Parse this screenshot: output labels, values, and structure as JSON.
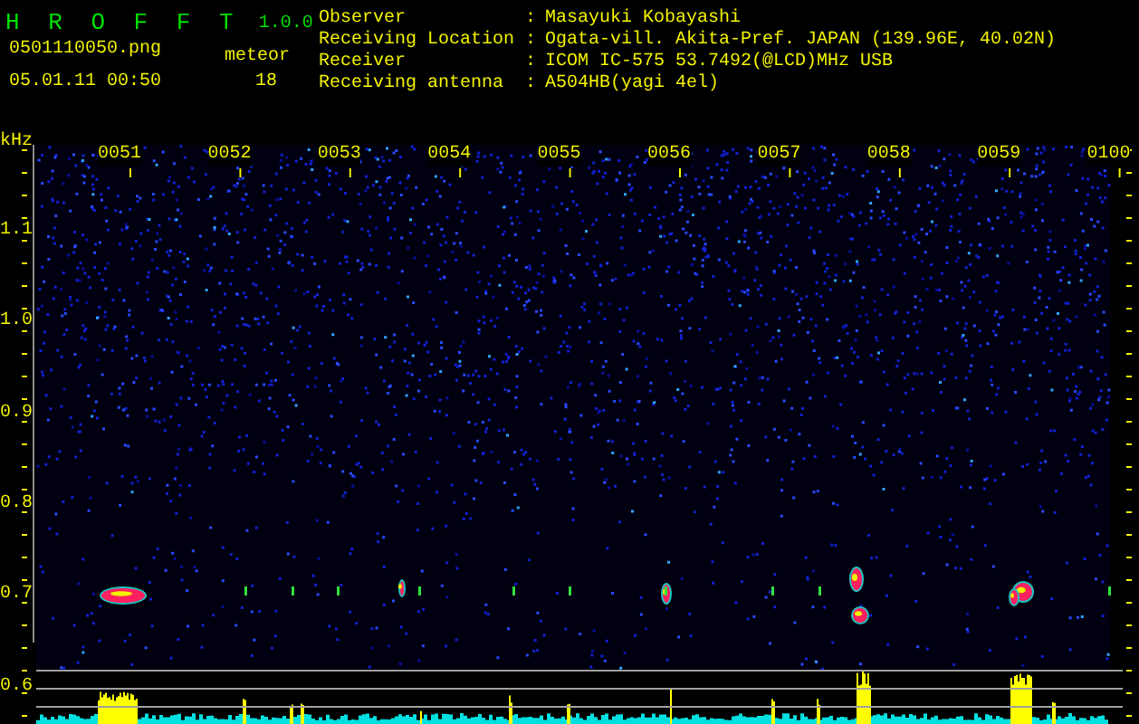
{
  "app": {
    "title": "H R O F F T",
    "version": "1.0.0"
  },
  "file": {
    "name": "0501110050.png",
    "datetime": "05.01.11 00:50"
  },
  "meteor": {
    "label": "meteor",
    "count": "18"
  },
  "info": [
    {
      "label": "Observer",
      "colon": ":",
      "value": "Masayuki Kobayashi"
    },
    {
      "label": "Receiving Location",
      "colon": ":",
      "value": "Ogata-vill. Akita-Pref. JAPAN (139.96E, 40.02N)"
    },
    {
      "label": "Receiver",
      "colon": ":",
      "value": "ICOM IC-575 53.7492(@LCD)MHz USB"
    },
    {
      "label": "Receiving antenna",
      "colon": ":",
      "value": "A504HB(yagi 4el)"
    }
  ],
  "plot": {
    "y_unit": "kHz",
    "y_labels": [
      "1.1",
      "1.0",
      "0.9",
      "0.8",
      "0.7",
      "0.6"
    ],
    "time_labels": [
      "0051",
      "0052",
      "0053",
      "0054",
      "0055",
      "0056",
      "0057",
      "0058",
      "0059",
      "0100"
    ]
  }
}
